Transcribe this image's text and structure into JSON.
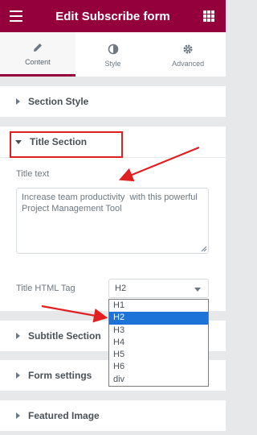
{
  "header": {
    "title": "Edit Subscribe form"
  },
  "tabs": [
    {
      "label": "Content",
      "icon": "pencil-icon",
      "active": true
    },
    {
      "label": "Style",
      "icon": "half-circle-icon",
      "active": false
    },
    {
      "label": "Advanced",
      "icon": "gear-icon",
      "active": false
    }
  ],
  "sections": {
    "section_style": "Section Style",
    "title_section": "Title Section",
    "subtitle_section": "Subtitle Section",
    "form_settings": "Form settings",
    "featured_image": "Featured Image"
  },
  "title_section": {
    "title_text_label": "Title text",
    "title_text_value": "Increase team productivity  with this powerful Project Management Tool",
    "html_tag_label": "Title HTML Tag",
    "html_tag_value": "H2",
    "html_tag_options": [
      "H1",
      "H2",
      "H3",
      "H4",
      "H5",
      "H6",
      "div"
    ]
  },
  "colors": {
    "brand": "#93003c",
    "highlight": "#1e73d8",
    "annotation": "#e02020"
  }
}
